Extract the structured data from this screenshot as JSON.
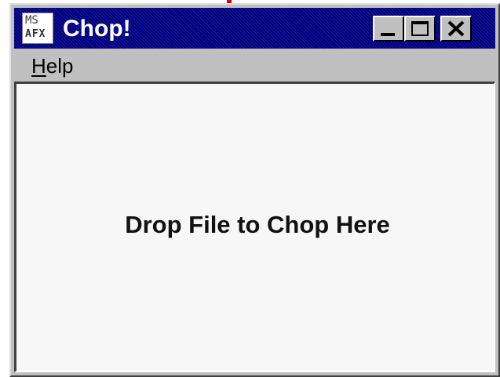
{
  "window": {
    "title": "Chop!",
    "icon": {
      "name": "msafx-app-icon",
      "line1": "MS",
      "line2": "AFX"
    },
    "controls": {
      "minimize": "minimize-icon",
      "maximize": "maximize-icon",
      "close": "close-icon"
    }
  },
  "menu": {
    "items": [
      {
        "mnemonic": "H",
        "rest": "elp"
      }
    ]
  },
  "client": {
    "drop_text": "Drop File to Chop Here"
  },
  "colors": {
    "titlebar": "#000080",
    "face": "#c0c0c0",
    "client_bg": "#f7f7f7",
    "accent_mark": "#e00000"
  }
}
